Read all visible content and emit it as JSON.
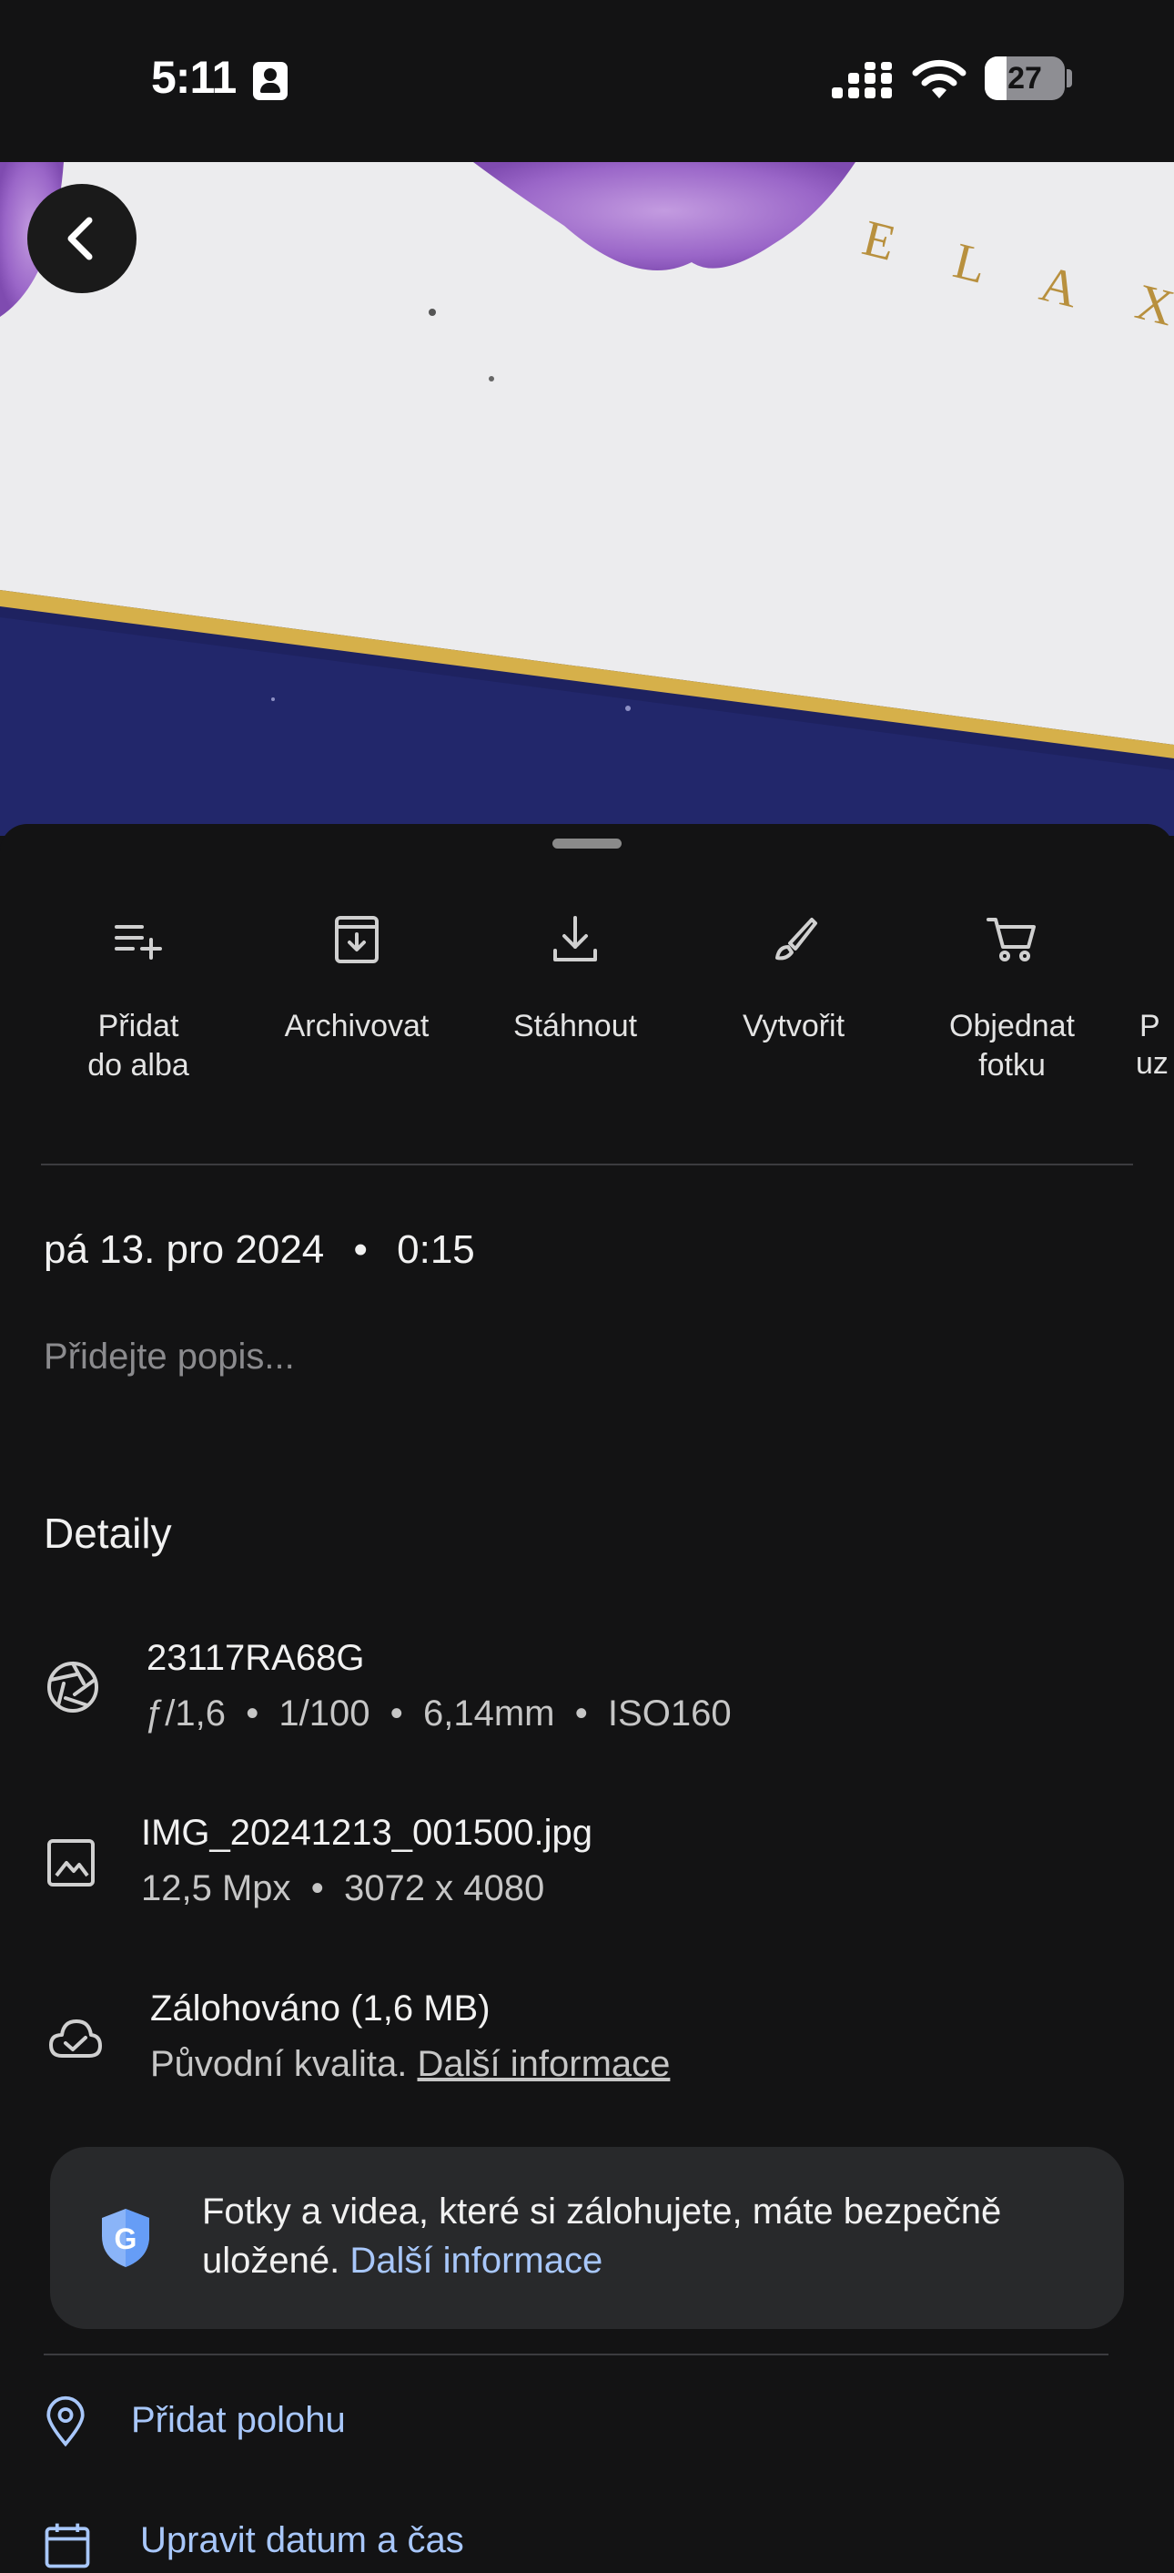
{
  "status_bar": {
    "time": "5:11",
    "battery_level": "27",
    "battery_fraction": 0.27,
    "icons": [
      "contact-card-icon",
      "cellular-signal-icon",
      "wifi-icon",
      "battery-icon"
    ]
  },
  "photo": {
    "visible_letters": [
      "E",
      "L",
      "A",
      "X"
    ]
  },
  "back_button": {
    "icon": "chevron-left-icon"
  },
  "actions": [
    {
      "line1": "Přidat",
      "line2": "do alba",
      "icon": "playlist-add-icon"
    },
    {
      "line1": "Archivovat",
      "line2": "",
      "icon": "archive-icon"
    },
    {
      "line1": "Stáhnout",
      "line2": "",
      "icon": "download-icon"
    },
    {
      "line1": "Vytvořit",
      "line2": "",
      "icon": "brush-icon"
    },
    {
      "line1": "Objednat",
      "line2": "fotku",
      "icon": "shopping-cart-icon"
    },
    {
      "line1": "P",
      "line2": "uz",
      "icon": ""
    }
  ],
  "date": {
    "day": "pá 13. pro 2024",
    "separator": "•",
    "time": "0:15"
  },
  "description": {
    "placeholder": "Přidejte popis..."
  },
  "details": {
    "heading": "Detaily",
    "camera": {
      "model": "23117RA68G",
      "specs": "ƒ/1,6  •  1/100  •  6,14mm  •  ISO160",
      "icon": "aperture-icon"
    },
    "file": {
      "name": "IMG_20241213_001500.jpg",
      "specs": "12,5 Mpx  •  3072 x 4080",
      "icon": "image-icon"
    },
    "backup": {
      "title": "Zálohováno (1,6 MB)",
      "quality": "Původní kvalita.",
      "link": "Další informace",
      "icon": "cloud-done-icon"
    }
  },
  "info_card": {
    "text": "Fotky a videa, které si zálohujete, máte bezpečně uložené.",
    "link": "Další informace",
    "icon": "google-shield-icon"
  },
  "add_location": {
    "label": "Přidat polohu",
    "icon": "location-pin-icon"
  },
  "edit_datetime": {
    "label": "Upravit datum a čas",
    "icon": "calendar-icon"
  },
  "colors": {
    "background": "#131314",
    "accent": "#a8c7fa",
    "card": "#28292b"
  }
}
